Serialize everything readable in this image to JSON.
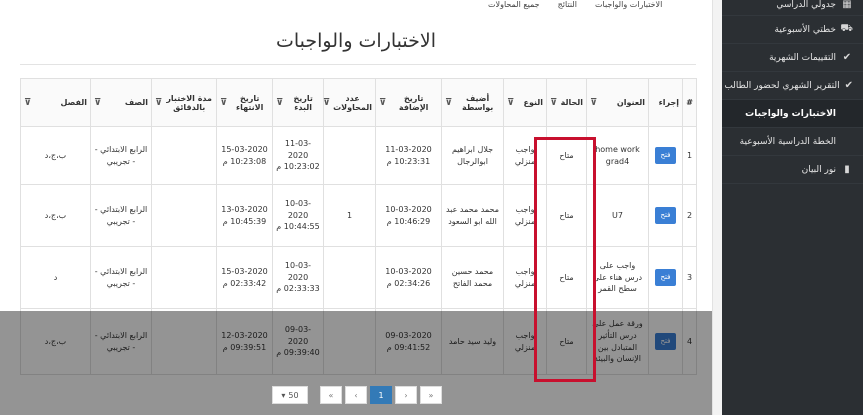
{
  "tabs": [
    "الاختبارات والواجبات",
    "النتائج",
    "جميع المحاولات"
  ],
  "page": {
    "title": "الاختبارات والواجبات"
  },
  "sidebar": {
    "items": [
      {
        "label": "جدولي الدراسي",
        "icon": "calendar-icon",
        "icon_glyph": "▦"
      },
      {
        "label": "خطتي الأسبوعية",
        "icon": "car-icon",
        "icon_glyph": "⛟"
      },
      {
        "label": "التقييمات الشهرية",
        "icon": "check-icon",
        "icon_glyph": "✔"
      },
      {
        "label": "التقرير الشهري لحضور الطالب",
        "icon": "check-icon",
        "icon_glyph": "✔"
      },
      {
        "label": "الاختبارات والواجبات",
        "icon": "",
        "icon_glyph": ""
      },
      {
        "label": "الخطة الدراسية الأسبوعية",
        "icon": "",
        "icon_glyph": ""
      },
      {
        "label": "نور البيان",
        "icon": "book-icon",
        "icon_glyph": "▮"
      }
    ]
  },
  "table": {
    "headers": [
      "#",
      "إجراء",
      "العنوان",
      "الحالة",
      "النوع",
      "أضيف بواسطة",
      "تاريخ الإضافة",
      "عدد المحاولات",
      "تاريخ البدء",
      "تاريخ الانتهاء",
      "مدة الاختبار بالدقائق",
      "الصف",
      "الفصل"
    ],
    "filter_glyph": "⊽",
    "open_label": "فتح",
    "rows": [
      [
        "1",
        "",
        "home work grad4",
        "متاح",
        "واجب منزلي",
        "جلال ابراهيم ابوالرجال",
        "11-03-2020 10:23:31 م",
        "",
        "11-03-2020 10:23:02 م",
        "15-03-2020 10:23:08 م",
        "",
        "الرابع الابتدائي -- تجريبي",
        "ب،ج،د"
      ],
      [
        "2",
        "",
        "U7",
        "متاح",
        "واجب منزلي",
        "محمد محمد عبد الله ابو السعود",
        "10-03-2020 10:46:29 م",
        "1",
        "10-03-2020 10:44:55 م",
        "13-03-2020 10:45:39 م",
        "",
        "الرابع الابتدائي -- تجريبي",
        "ب،ج،د"
      ],
      [
        "3",
        "",
        "واجب على درس هناء على سطح القمر",
        "متاح",
        "واجب منزلي",
        "محمد حسين محمد الفاتح",
        "10-03-2020 02:34:26 م",
        "",
        "10-03-2020 02:33:33 م",
        "15-03-2020 02:33:42 م",
        "",
        "الرابع الابتدائي -- تجريبي",
        "د"
      ],
      [
        "4",
        "",
        "ورقة عمل على درس التأثير المتبادل بين الإنسان والبيئة",
        "متاح",
        "واجب منزلي",
        "وليد سيد حامد",
        "09-03-2020 09:41:52 م",
        "",
        "09-03-2020 09:39:40 م",
        "12-03-2020 09:39:51 م",
        "",
        "الرابع الابتدائي -- تجريبي",
        "ب،ج،د"
      ]
    ]
  },
  "pager": {
    "page_size": "50",
    "buttons": [
      "«",
      "‹",
      "1",
      "›",
      "»"
    ],
    "active": "1"
  }
}
